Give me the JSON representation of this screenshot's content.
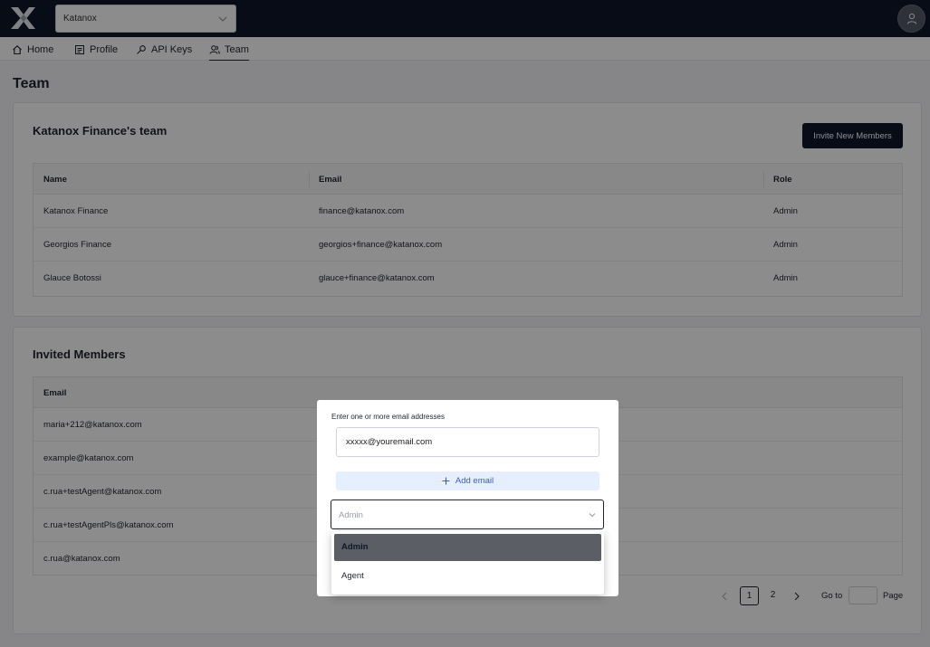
{
  "topbar": {
    "org_select_value": "Katanox"
  },
  "nav": {
    "tabs": [
      {
        "label": "Home",
        "icon": "home-icon"
      },
      {
        "label": "Profile",
        "icon": "profile-icon"
      },
      {
        "label": "API Keys",
        "icon": "key-icon"
      },
      {
        "label": "Team",
        "icon": "team-icon",
        "active": true
      }
    ]
  },
  "page": {
    "title": "Team"
  },
  "team_card": {
    "title": "Katanox Finance's team",
    "invite_button": "Invite New Members",
    "columns": [
      "Name",
      "Email",
      "Role"
    ],
    "rows": [
      {
        "name": "Katanox Finance",
        "email": "finance@katanox.com",
        "role": "Admin"
      },
      {
        "name": "Georgios Finance",
        "email": "georgios+finance@katanox.com",
        "role": "Admin"
      },
      {
        "name": "Glauce Botossi",
        "email": "glauce+finance@katanox.com",
        "role": "Admin"
      }
    ]
  },
  "invited_card": {
    "title": "Invited Members",
    "columns": [
      "Email"
    ],
    "rows": [
      {
        "email": "maria+212@katanox.com"
      },
      {
        "email": "example@katanox.com"
      },
      {
        "email": "c.rua+testAgent@katanox.com"
      },
      {
        "email": "c.rua+testAgentPls@katanox.com"
      },
      {
        "email": "c.rua@katanox.com"
      }
    ],
    "pagination": {
      "pages": [
        "1",
        "2"
      ],
      "current": "1",
      "goto_label": "Go to",
      "page_label": "Page"
    }
  },
  "modal": {
    "label": "Enter one or more email addresses",
    "email_value": "xxxxx@youremail.com",
    "add_email_label": "Add email",
    "role_placeholder": "Admin",
    "role_options": [
      "Admin",
      "Agent"
    ],
    "role_selected": "Admin"
  },
  "colors": {
    "topbar": "#0f172a",
    "primary_button": "#0f172a",
    "add_email_bg": "#e6efff",
    "add_email_text": "#3b5bdb"
  }
}
